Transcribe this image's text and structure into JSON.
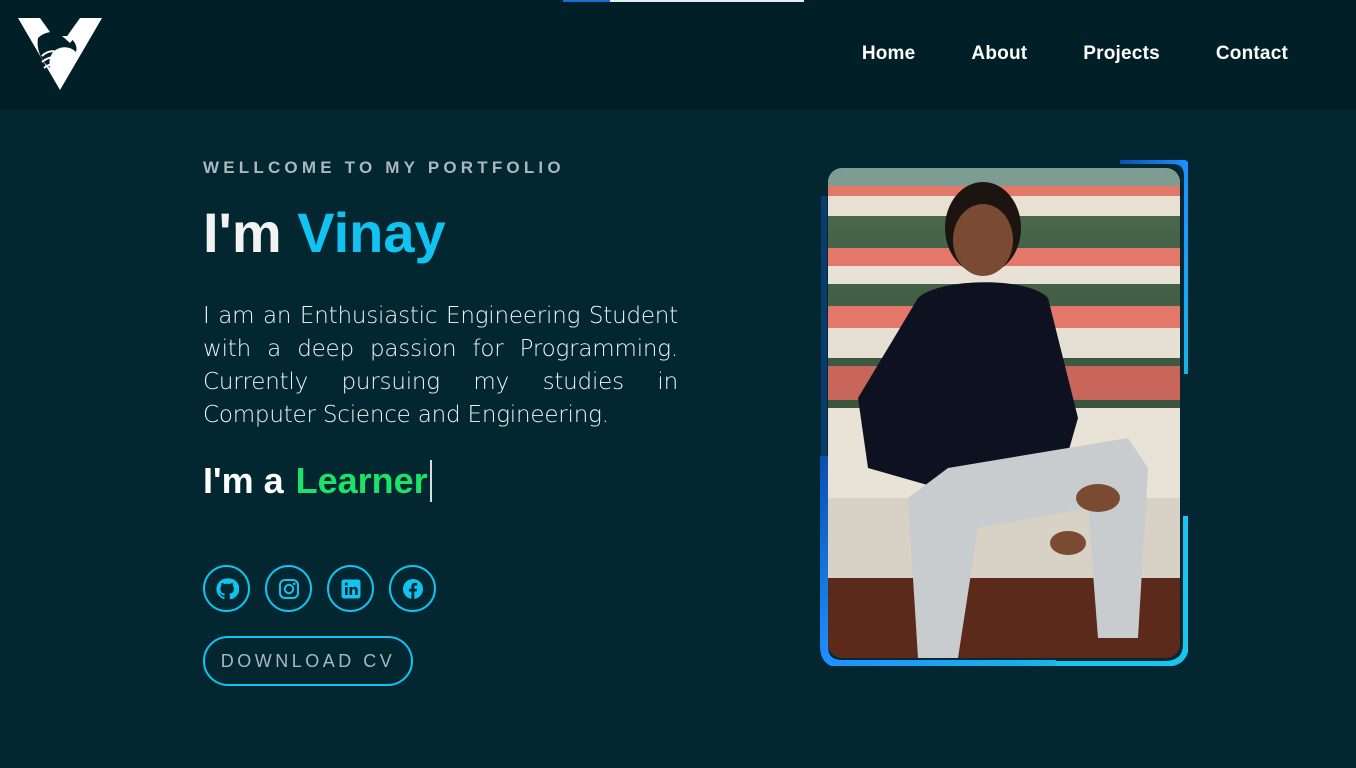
{
  "brand": {
    "logo_icon": "eagle-v-logo-icon"
  },
  "nav": {
    "items": [
      {
        "label": "Home"
      },
      {
        "label": "About"
      },
      {
        "label": "Projects"
      },
      {
        "label": "Contact"
      }
    ]
  },
  "hero": {
    "kicker": "WELLCOME TO MY PORTFOLIO",
    "title_prefix": "I'm",
    "title_name": "Vinay",
    "description": "I am an Enthusiastic Engineering Student with a deep passion for Programming. Currently pursuing my studies in Computer Science and Engineering.",
    "role_prefix": "I'm a",
    "role_word": "Learner",
    "download_label": "DOWNLOAD CV"
  },
  "socials": [
    {
      "icon": "github-icon"
    },
    {
      "icon": "instagram-icon"
    },
    {
      "icon": "linkedin-icon"
    },
    {
      "icon": "facebook-icon"
    }
  ],
  "colors": {
    "background": "#022730",
    "header": "#011f26",
    "accent": "#11c3f0",
    "role_accent": "#1be36a"
  }
}
